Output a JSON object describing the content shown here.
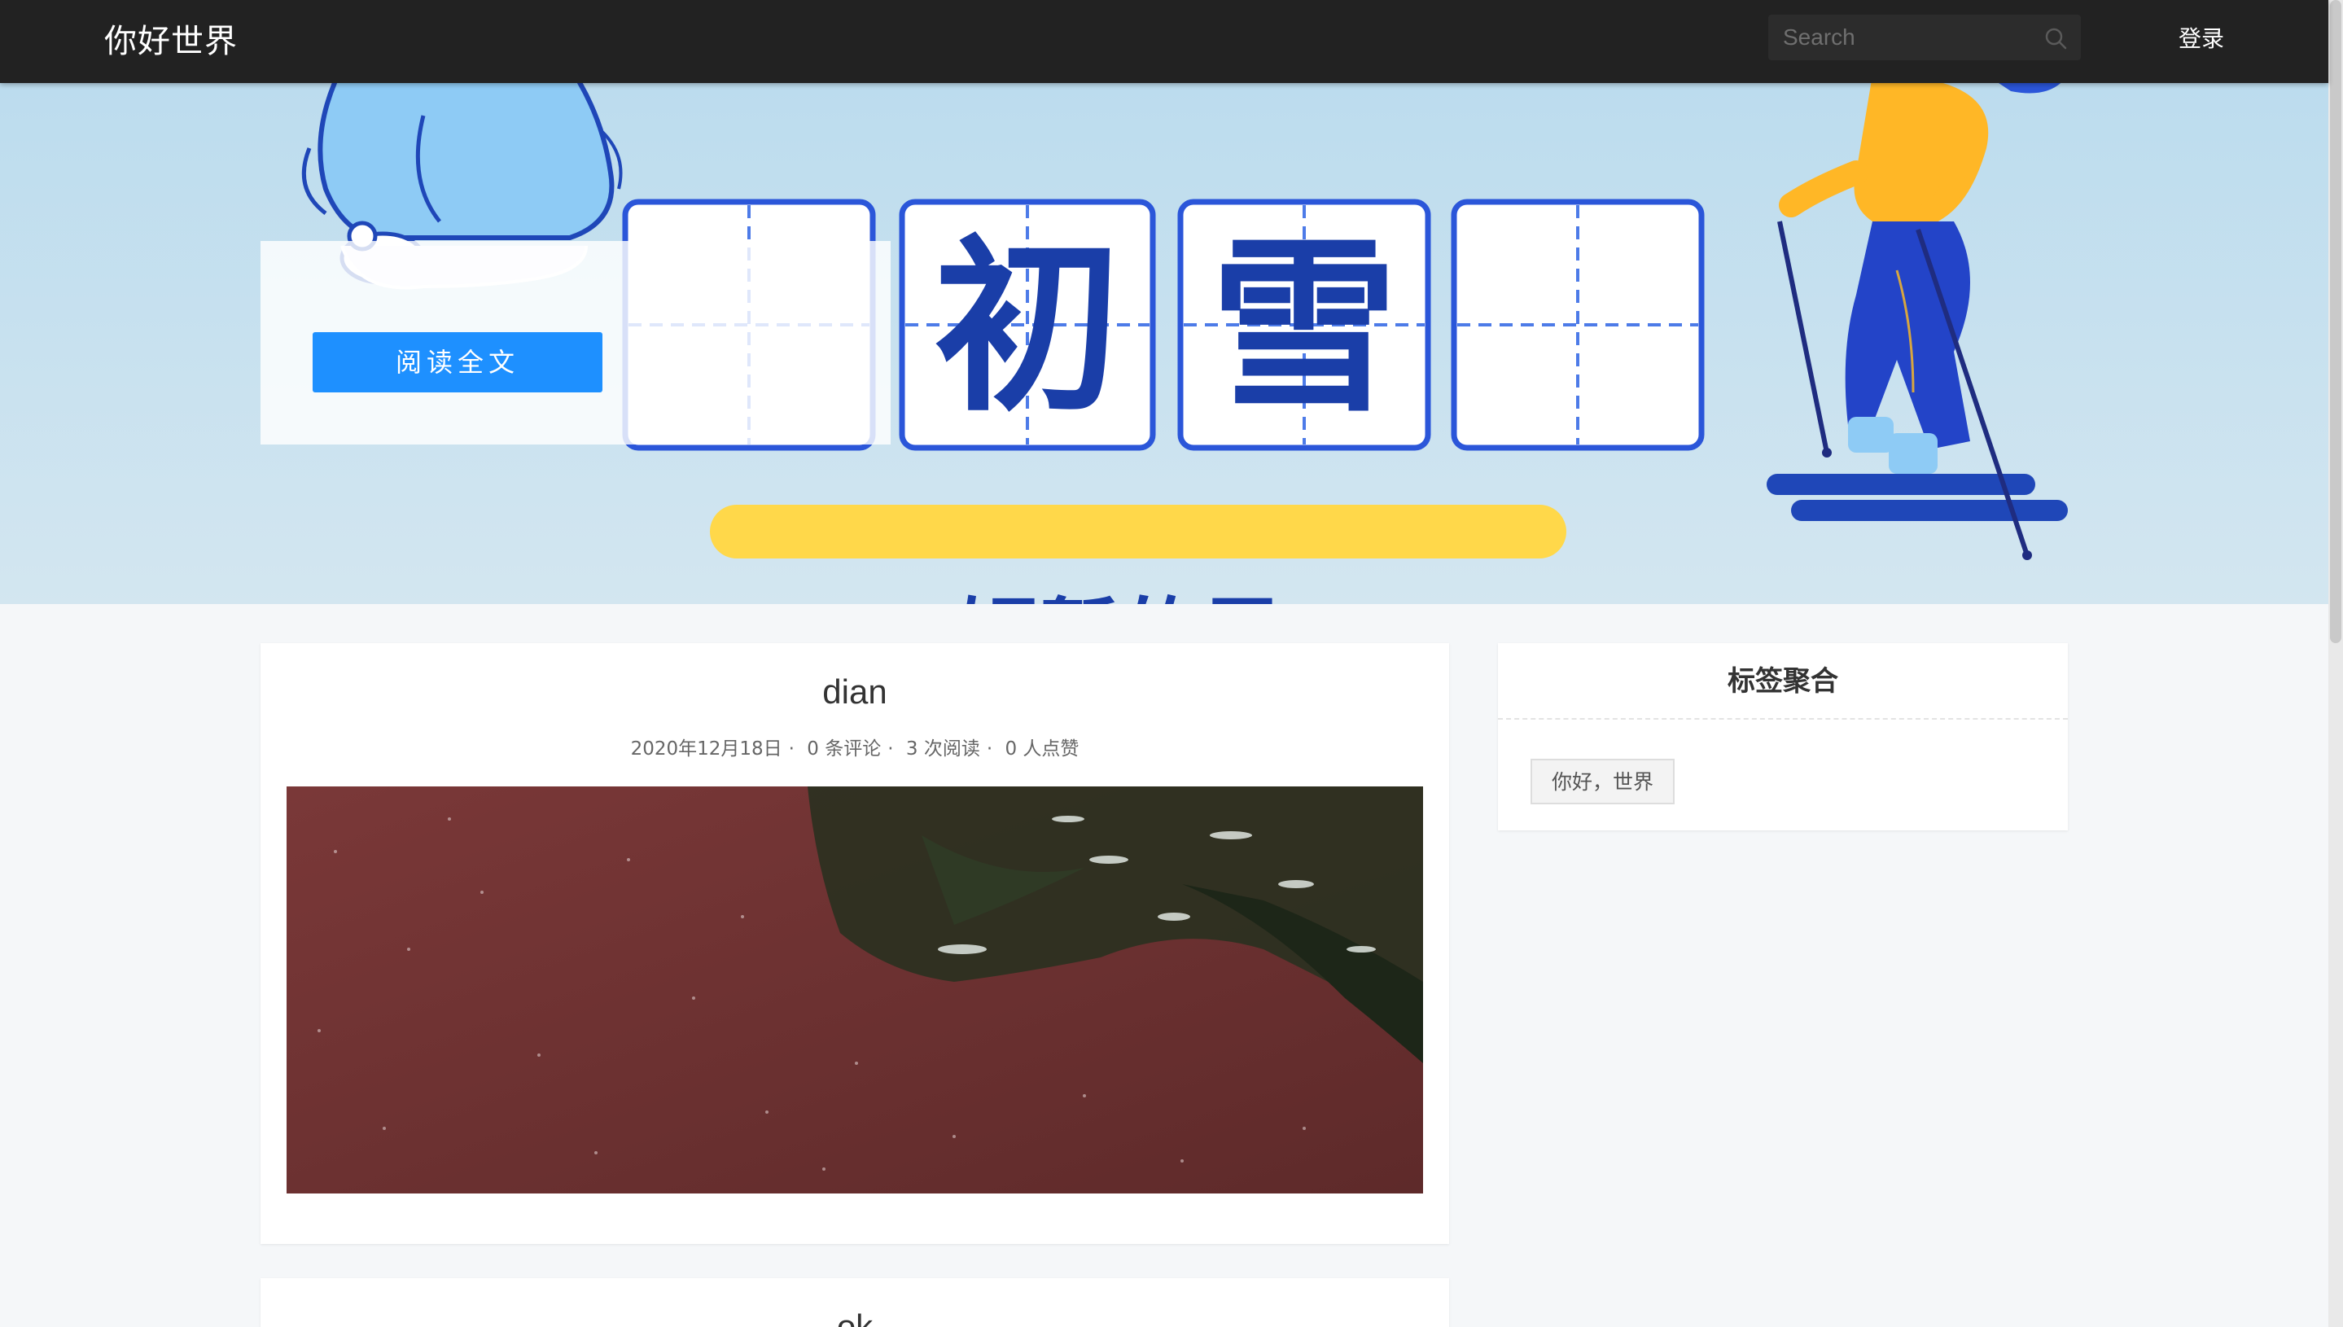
{
  "nav": {
    "brand": "你好世界",
    "search_placeholder": "Search",
    "login": "登录"
  },
  "banner": {
    "chars": [
      "初",
      "雪"
    ],
    "subtitle": "短暂的雪",
    "read_button": "阅读全文"
  },
  "posts": [
    {
      "title": "dian",
      "date": "2020年12月18日",
      "comments": "0 条评论",
      "reads": "3 次阅读",
      "likes": "0 人点赞",
      "meta_sep": "·"
    },
    {
      "title": "ok"
    }
  ],
  "sidebar": {
    "tags_title": "标签聚合",
    "tags": [
      "你好，世界"
    ]
  },
  "colors": {
    "nav_bg": "#222222",
    "accent": "#1e90ff",
    "banner_blue": "#1a3ea8",
    "banner_yellow": "#ffd84a"
  }
}
